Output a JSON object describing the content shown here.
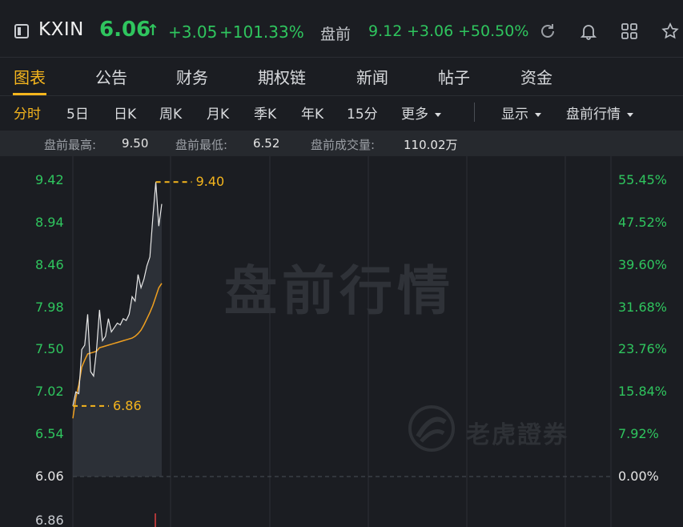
{
  "header": {
    "sidebar_icon": "sidebar-toggle-icon",
    "symbol": "KXIN",
    "price": "6.06",
    "price_arrow": "↑",
    "change": "+3.05",
    "change_pct": "+101.33%",
    "premarket_label": "盘前",
    "premarket_price": "9.12",
    "premarket_change": "+3.06",
    "premarket_change_pct": "+50.50%",
    "icons": [
      "refresh-icon",
      "bell-icon",
      "grid-icon",
      "star-icon"
    ]
  },
  "tabs": [
    {
      "label": "图表",
      "active": true
    },
    {
      "label": "公告",
      "active": false
    },
    {
      "label": "财务",
      "active": false
    },
    {
      "label": "期权链",
      "active": false
    },
    {
      "label": "新闻",
      "active": false
    },
    {
      "label": "帖子",
      "active": false
    },
    {
      "label": "资金",
      "active": false
    }
  ],
  "periods": {
    "items": [
      "分时",
      "5日",
      "日K",
      "周K",
      "月K",
      "季K",
      "年K",
      "15分",
      "更多"
    ],
    "active": "分时",
    "display": "显示",
    "premarket_quote": "盘前行情"
  },
  "stats": {
    "high_label": "盘前最高:",
    "high_value": "9.50",
    "low_label": "盘前最低:",
    "low_value": "6.52",
    "volume_label": "盘前成交量:",
    "volume_value": "110.02万"
  },
  "chart_data": {
    "type": "line",
    "watermark": "盘前行情",
    "brand": "老虎證券",
    "y_left_labels": [
      "9.42",
      "8.94",
      "8.46",
      "7.98",
      "7.50",
      "7.02",
      "6.54",
      "6.06"
    ],
    "y_right_labels": [
      "55.45%",
      "47.52%",
      "39.60%",
      "31.68%",
      "23.76%",
      "15.84%",
      "7.92%",
      "0.00%"
    ],
    "lower_axis_label": "6.86",
    "ylim": [
      6.06,
      9.42
    ],
    "high_marker": "9.40",
    "low_marker": "6.86",
    "series": [
      {
        "name": "",
        "color": "#e8e8e8",
        "values": [
          6.86,
          7.02,
          7.0,
          7.5,
          7.55,
          7.9,
          7.25,
          7.2,
          7.5,
          7.95,
          7.6,
          7.65,
          7.85,
          7.7,
          7.75,
          7.8,
          7.78,
          7.85,
          7.83,
          7.9,
          8.1,
          8.05,
          8.35,
          8.2,
          8.3,
          8.45,
          8.55,
          9.0,
          9.4,
          8.9,
          9.15
        ]
      },
      {
        "name": "",
        "color": "#f0a020",
        "values": [
          6.72,
          6.95,
          7.1,
          7.3,
          7.38,
          7.45,
          7.46,
          7.47,
          7.48,
          7.52,
          7.53,
          7.54,
          7.55,
          7.56,
          7.57,
          7.58,
          7.59,
          7.6,
          7.61,
          7.62,
          7.63,
          7.65,
          7.68,
          7.72,
          7.78,
          7.85,
          7.92,
          8.0,
          8.1,
          8.2,
          8.25
        ]
      }
    ]
  }
}
